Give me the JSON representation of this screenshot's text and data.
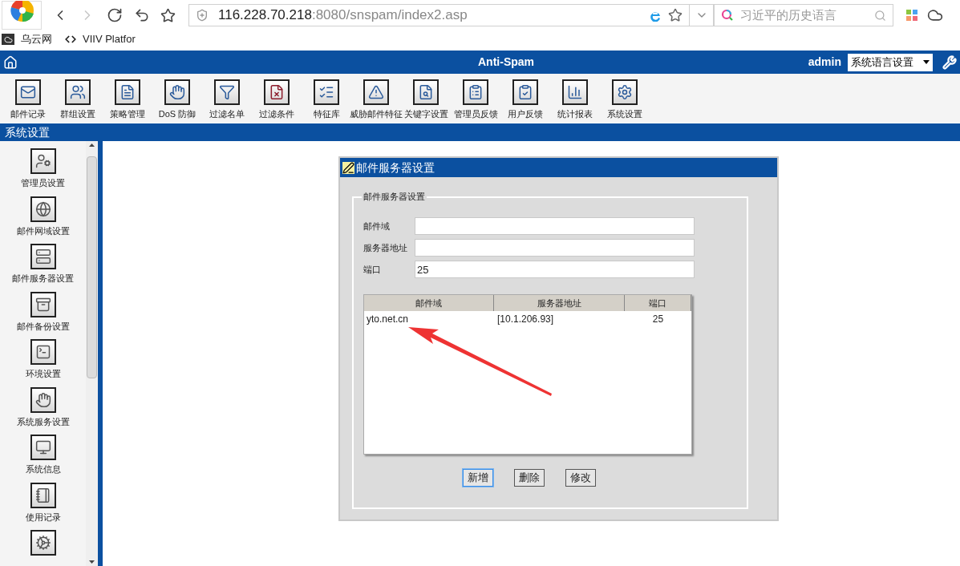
{
  "browser": {
    "nav": [
      {
        "kind": "back",
        "disabled": false
      },
      {
        "kind": "forward",
        "disabled": true
      },
      {
        "kind": "reload",
        "disabled": false
      },
      {
        "kind": "undo",
        "disabled": false
      }
    ],
    "url_host": "116.228.70.218",
    "url_rest": ":8080/snspam/index2.asp",
    "search_placeholder": "习近平的历史语言",
    "bookmarks": [
      {
        "kind": "cloud",
        "label": "乌云网"
      },
      {
        "kind": "code",
        "label": "VIIV Platfor"
      }
    ]
  },
  "header": {
    "title": "Anti-Spam",
    "user": "admin",
    "language_select": "系统语言设置"
  },
  "toolbar": [
    {
      "label": "邮件记录"
    },
    {
      "label": "群组设置"
    },
    {
      "label": "策略管理"
    },
    {
      "label": "DoS 防御"
    },
    {
      "label": "过滤名单"
    },
    {
      "label": "过滤条件"
    },
    {
      "label": "特征库"
    },
    {
      "label": "威胁邮件特征"
    },
    {
      "label": "关键字设置"
    },
    {
      "label": "管理员反馈"
    },
    {
      "label": "用户反馈"
    },
    {
      "label": "统计报表"
    },
    {
      "label": "系统设置"
    }
  ],
  "section_title": "系统设置",
  "sidebar": {
    "items": [
      {
        "label": "管理员设置"
      },
      {
        "label": "邮件网域设置"
      },
      {
        "label": "邮件服务器设置"
      },
      {
        "label": "邮件备份设置"
      },
      {
        "label": "环境设置"
      },
      {
        "label": "系统服务设置"
      },
      {
        "label": "系统信息"
      },
      {
        "label": "使用记录"
      }
    ],
    "partial_item": true
  },
  "dialog": {
    "title": "邮件服务器设置",
    "legend": "邮件服务器设置",
    "fields": [
      {
        "label": "邮件域"
      },
      {
        "label": "服务器地址"
      },
      {
        "label": "端口",
        "value": "25"
      }
    ],
    "table": {
      "columns": [
        "邮件域",
        "服务器地址",
        "端口"
      ],
      "rows": [
        [
          "yto.net.cn",
          "[10.1.206.93]",
          "25"
        ]
      ]
    },
    "buttons": [
      {
        "label": "新增",
        "focused": true
      },
      {
        "label": "删除",
        "focused": false
      },
      {
        "label": "修改",
        "focused": false
      }
    ]
  }
}
